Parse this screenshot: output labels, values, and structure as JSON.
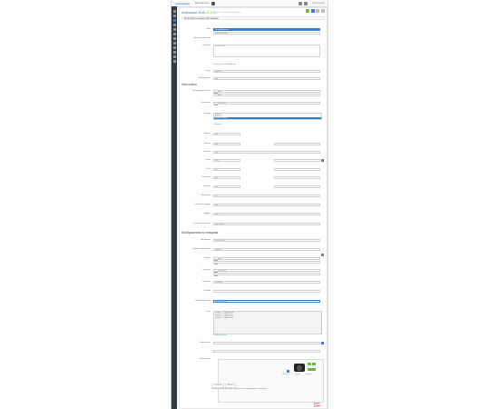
{
  "topbar": {
    "brand": "prestashop",
    "store_label": "Мой магазин",
    "right_text": "Ещё ссылки"
  },
  "page": {
    "title_main": "Iridescent Roll ",
    "title_version": "v1.0.0",
    "breadcrumb": "Каталог / Товары / Изменить",
    "panel_head": "Подготовительный ■ Мой магазин"
  },
  "sections": {
    "settings": "Настройки",
    "product_images": "Изображения по товарам"
  },
  "fields": {
    "language_label": "Язык",
    "language_value": "Русский (Russian)",
    "language_option": "English (English)",
    "description_label": "Описание",
    "description_value": "Подробности",
    "hint_link": "Дополнительная информация",
    "option1_label": "Краткое содержание",
    "option2_label": "Статус",
    "option2_value": "Включено",
    "img_alt_label": "Альтернативный текст",
    "img_alt_value": "Rolls",
    "img_alt_value2": "Rolls",
    "manuf_label": "Производитель",
    "manuf_value": "Нет",
    "show_label": "Показывать",
    "show_value": "Показывать",
    "list_items": [
      "Вариант 1",
      "Вариант 2",
      "Вариант 3"
    ],
    "list_active": "Вариант активен",
    "small_link": "+ Добавить",
    "slide_label": "Слайдер",
    "width_label": "Ширина",
    "width_value": "300",
    "height_label": "Высота",
    "height_value": "200",
    "speed_label": "Скорость",
    "speed_value": "500",
    "pause_label": "Пауза",
    "pause_value": "3000",
    "loop_label": "Цикл",
    "loop_value": "Да",
    "nav_label": "Навигация",
    "nav_value": "Да",
    "pager_label": "Пейджер",
    "pager_value": "Нет",
    "auto_label": "Автозапуск",
    "auto_value": "Да",
    "random_label": "Случайный порядок",
    "random_value": "Нет",
    "effect_label": "Эффект",
    "effect_value": "slide",
    "img_size_label": "Размер изображения",
    "img_size_value": "large_default",
    "thumbs_label": "Миниатюры",
    "thumbs_value": "small_default",
    "caption_label": "Подпись изображения",
    "caption_value": "Подпись",
    "link_label": "Ссылка",
    "link_value": "http://",
    "target_label": "Открыть в",
    "target_value": "Новом окне",
    "title_label": "Заголовок",
    "title_value": "Заголовок",
    "textarea_label": "Текст",
    "textarea_lines": [
      "Строка 1 — Подробности",
      "Строка 2 — Подробности",
      "Строка 3 — Подробности",
      "Строка 4 — Подробности"
    ],
    "more_link": "Показать больше",
    "file_label": "Файл изображения",
    "file_value": "Выберите файл",
    "position_label": "Позиция",
    "position_value": "1",
    "images_label": "Изображения"
  },
  "image_panel": {
    "tab1": "Основное",
    "tab2": "Детали",
    "caption_left": "Обложка",
    "caption_mid": "Удалить",
    "caption_right": "Изменить",
    "desc": "Описание изображения товара с дополнительной информацией для покупателей."
  },
  "watermark": "photo-keeper"
}
